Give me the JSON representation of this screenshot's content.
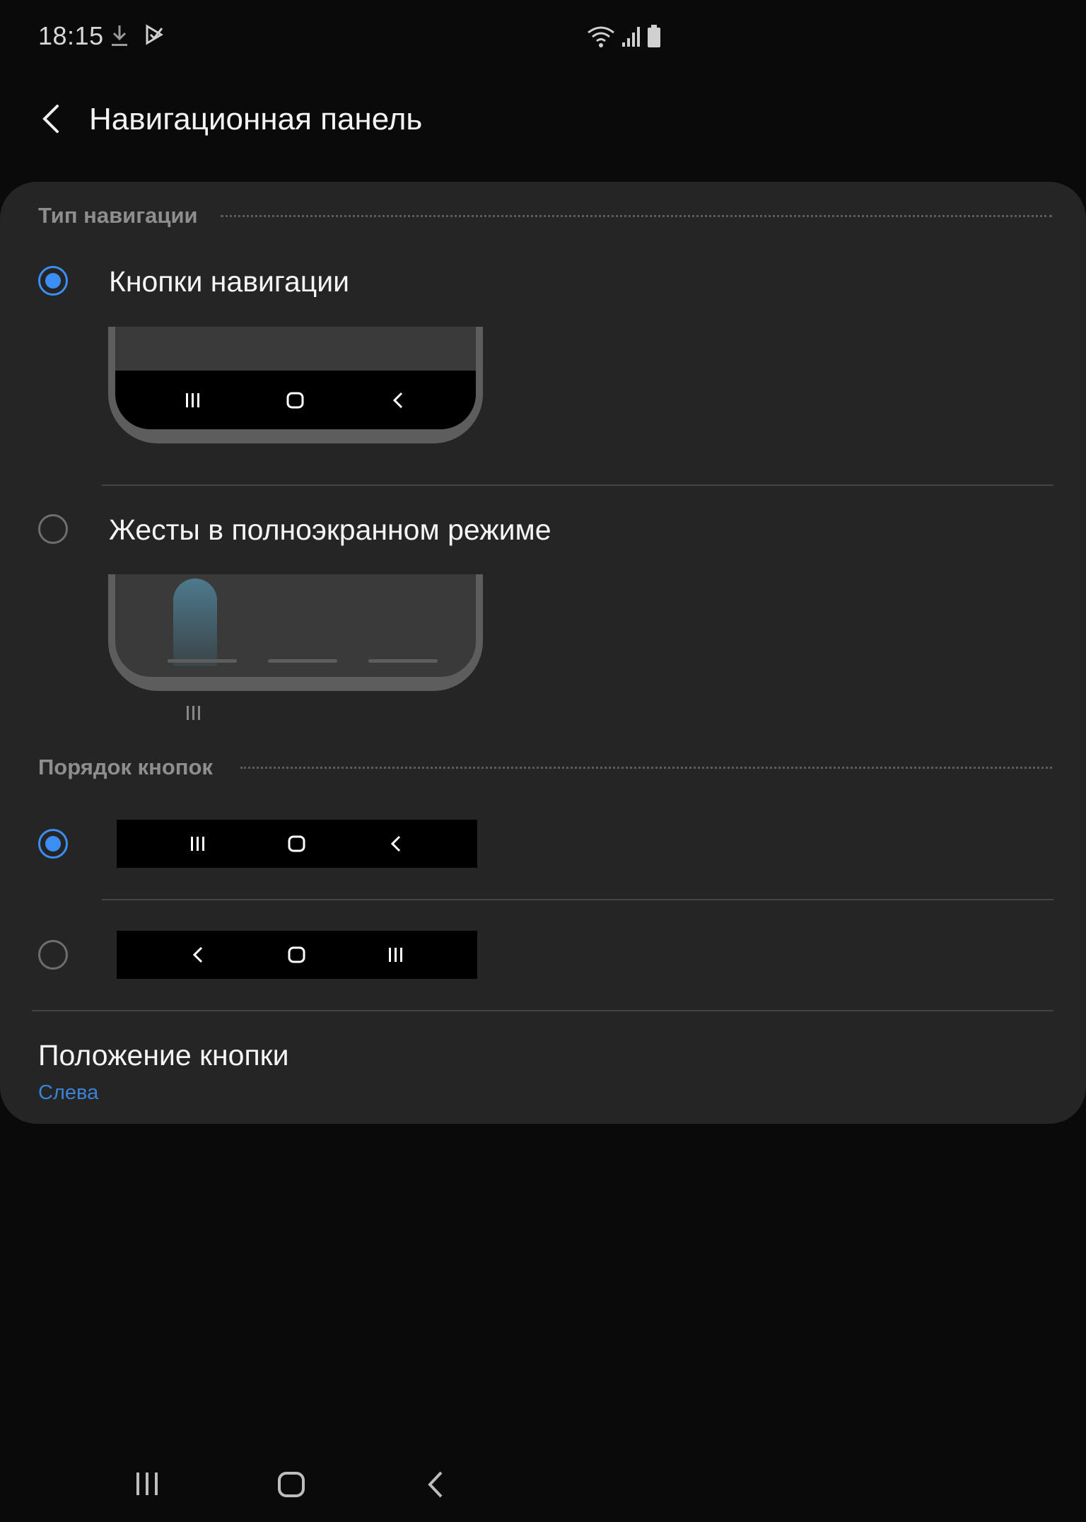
{
  "status_bar": {
    "time": "18:15",
    "left_icons": [
      "download-icon",
      "play-store-icon"
    ],
    "right_icons": [
      "wifi-icon",
      "signal-icon",
      "battery-icon"
    ]
  },
  "header": {
    "title": "Навигационная панель",
    "back_icon": "chevron-left-icon"
  },
  "nav_type": {
    "section_title": "Тип навигации",
    "options": [
      {
        "label": "Кнопки навигации",
        "selected": true
      },
      {
        "label": "Жесты в полноэкранном режиме",
        "selected": false
      }
    ]
  },
  "button_order": {
    "section_title": "Порядок кнопок",
    "options": [
      {
        "order": [
          "recents",
          "home",
          "back"
        ],
        "selected": true
      },
      {
        "order": [
          "back",
          "home",
          "recents"
        ],
        "selected": false
      }
    ]
  },
  "button_position": {
    "title": "Положение кнопки",
    "value": "Слева"
  },
  "colors": {
    "accent": "#3c8ef5",
    "card_background": "#252526",
    "page_background": "#0a0a0a",
    "link_value": "#3b82d6"
  }
}
